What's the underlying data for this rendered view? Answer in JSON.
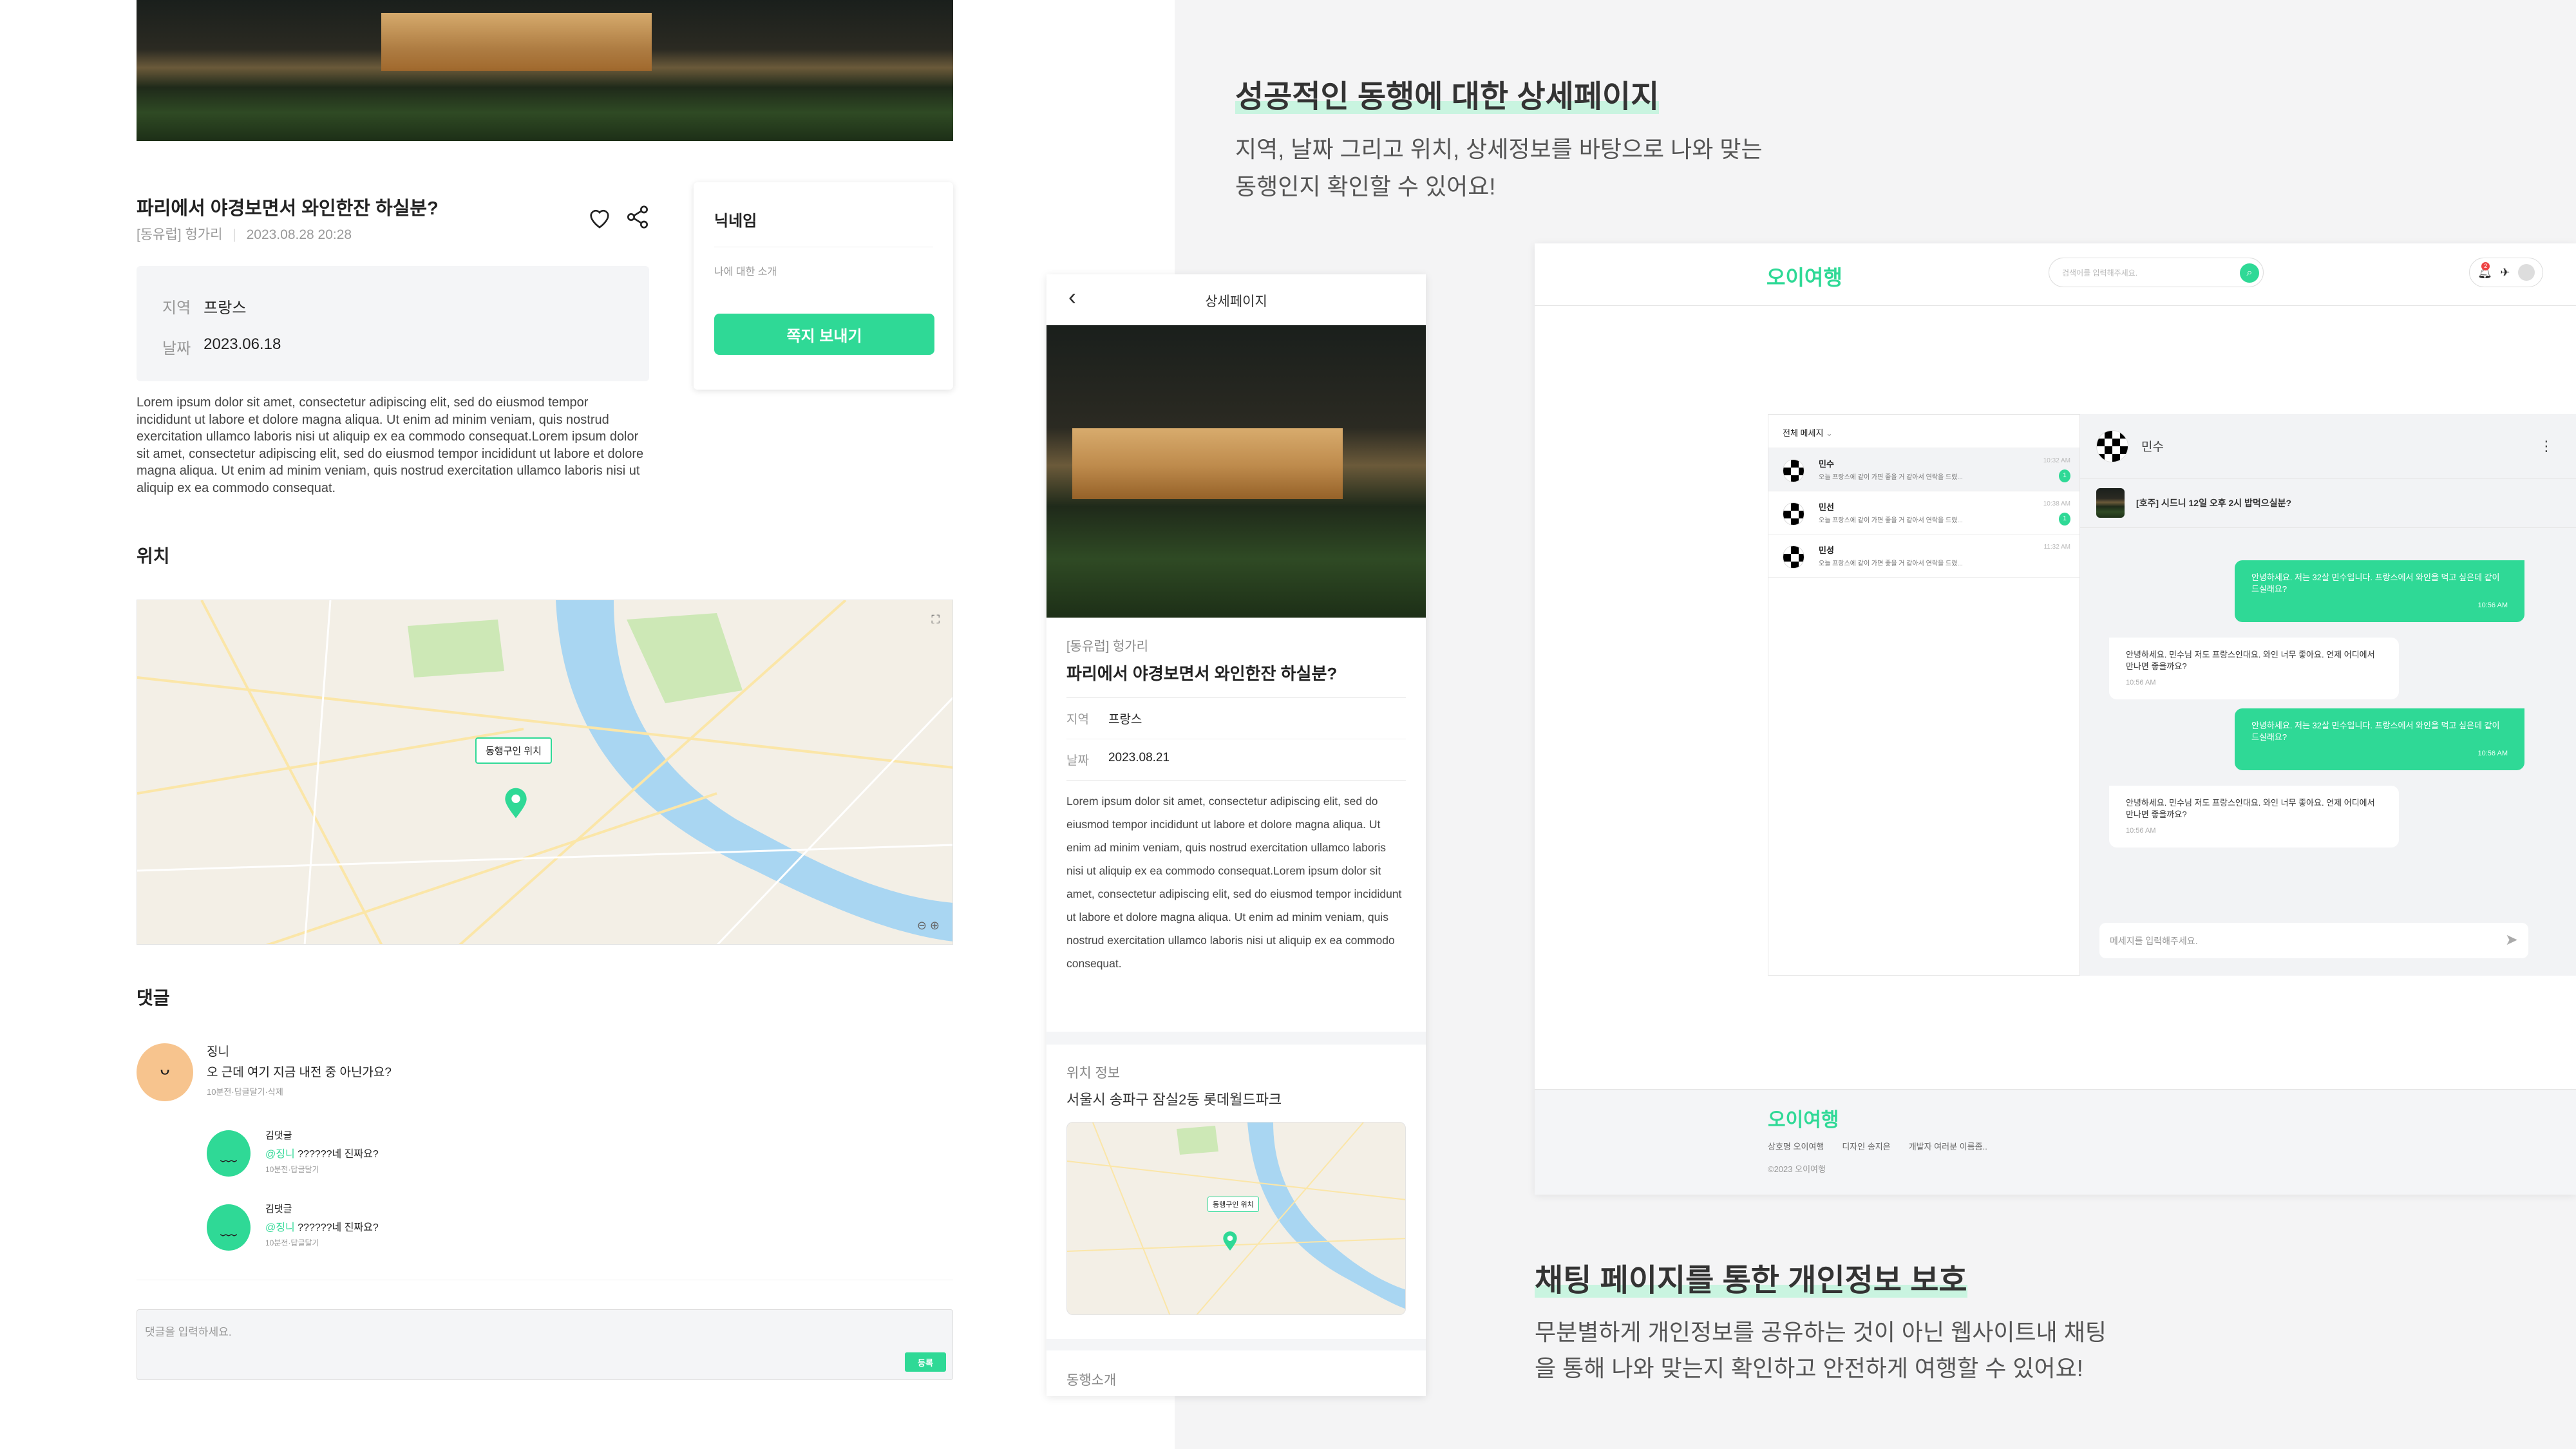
{
  "detail_web": {
    "title": "파리에서 야경보면서 와인한잔 하실분?",
    "category": "[동유럽] 헝가리",
    "posted_at": "2023.08.28 20:28",
    "info": [
      {
        "label": "지역",
        "value": "프랑스"
      },
      {
        "label": "날짜",
        "value": "2023.06.18"
      }
    ],
    "body": "Lorem ipsum dolor sit amet, consectetur adipiscing elit, sed do eiusmod tempor incididunt ut labore et dolore magna aliqua. Ut enim ad minim veniam, quis nostrud exercitation ullamco laboris nisi ut aliquip ex ea commodo consequat.Lorem ipsum dolor sit amet, consectetur adipiscing elit, sed do eiusmod tempor incididunt ut labore et dolore magna aliqua. Ut enim ad minim veniam, quis nostrud exercitation ullamco laboris nisi ut aliquip ex ea commodo consequat.",
    "location_heading": "위치",
    "map_label": "동행구인 위치",
    "profile": {
      "nickname": "닉네임",
      "intro": "나에 대한 소개",
      "message_button": "쪽지 보내기"
    },
    "comments_heading": "댓글",
    "comments": [
      {
        "author": "징니",
        "text": "오 근데 여기 지금 내전 중 아닌가요?",
        "meta": "10분전·답글달기·삭제"
      }
    ],
    "replies": [
      {
        "author": "김댓글",
        "mention": "@징니",
        "text": "??????네 진짜요?",
        "meta": "10분전·답글달기"
      },
      {
        "author": "김댓글",
        "mention": "@징니",
        "text": "??????네 진짜요?",
        "meta": "10분전·답글달기"
      }
    ],
    "comment_placeholder": "댓글을 입력하세요.",
    "submit_button": "등록"
  },
  "detail_mobile": {
    "header_title": "상세페이지",
    "category": "[동유럽] 헝가리",
    "title": "파리에서 야경보면서 와인한잔 하실분?",
    "info": [
      {
        "label": "지역",
        "value": "프랑스"
      },
      {
        "label": "날짜",
        "value": "2023.08.21"
      }
    ],
    "body": "Lorem ipsum dolor sit amet, consectetur adipiscing elit, sed do eiusmod tempor incididunt ut labore et dolore magna aliqua. Ut enim ad minim veniam, quis nostrud exercitation ullamco laboris nisi ut aliquip ex ea commodo consequat.Lorem ipsum dolor sit amet, consectetur adipiscing elit, sed do eiusmod tempor incididunt ut labore et dolore magna aliqua. Ut enim ad minim veniam, quis nostrud exercitation ullamco laboris nisi ut aliquip ex ea commodo consequat.",
    "location_heading": "위치 정보",
    "address": "서울시 송파구 잠실2동 롯데월드파크",
    "map_label": "동행구인 위치",
    "intro_heading": "동행소개"
  },
  "section1": {
    "heading": "성공적인 동행에 대한 상세페이지",
    "desc_lines": [
      "지역, 날짜 그리고 위치, 상세정보를 바탕으로 나와 맞는",
      "동행인지 확인할 수 있어요!"
    ]
  },
  "section2": {
    "heading": "채팅 페이지를 통한 개인정보 보호",
    "desc_lines": [
      "무분별하게 개인정보를 공유하는 것이 아닌 웹사이트내 채팅",
      "을 통해 나와 맞는지 확인하고 안전하게 여행할 수 있어요!"
    ]
  },
  "chat_web": {
    "logo": "오이여행",
    "search_placeholder": "검색어를 입력해주세요.",
    "notification_count": "2",
    "list_filter": "전체 메세지",
    "conversations": [
      {
        "name": "민수",
        "preview": "오늘 프랑스에 같이 가면 좋을 거 같아서 연락을 드렸...",
        "time": "10:32 AM",
        "unread": "1"
      },
      {
        "name": "민선",
        "preview": "오늘 프랑스에 같이 가면 좋을 거 같아서 연락을 드렸...",
        "time": "10:38 AM",
        "unread": "1"
      },
      {
        "name": "민성",
        "preview": "오늘 프랑스에 같이 가면 좋을 거 같아서 연락을 드렸...",
        "time": "11:32 AM",
        "unread": ""
      }
    ],
    "room_name": "민수",
    "post_title": "[호주] 시드니 12일 오후 2시 밥먹으실분?",
    "messages": [
      {
        "from": "me",
        "text": "안녕하세요. 저는 32살 민수입니다. 프랑스에서 와인을 먹고 싶은데 같이 드실래요?",
        "time": "10:56 AM"
      },
      {
        "from": "other",
        "text": "안녕하세요. 민수님 저도 프랑스인대요. 와인 너무 좋아요. 언제 어디에서 만나면 좋을까요?",
        "time": "10:56 AM"
      },
      {
        "from": "me",
        "text": "안녕하세요. 저는 32살 민수입니다. 프랑스에서 와인을 먹고 싶은데 같이 드실래요?",
        "time": "10:56 AM"
      },
      {
        "from": "other",
        "text": "안녕하세요. 민수님 저도 프랑스인대요. 와인 너무 좋아요. 언제 어디에서 만나면 좋을까요?",
        "time": "10:56 AM"
      }
    ],
    "message_placeholder": "메세지를 입력해주세요.",
    "footer": {
      "logo": "오이여행",
      "links": [
        "상호명 오이여행",
        "디자인 송지은",
        "개발자 여러분 이름좀.."
      ],
      "copyright": "©2023 오이여행"
    }
  },
  "colors": {
    "accent": "#2fd996",
    "background": "#f4f4f5",
    "highlight": "#c9f4e0"
  }
}
